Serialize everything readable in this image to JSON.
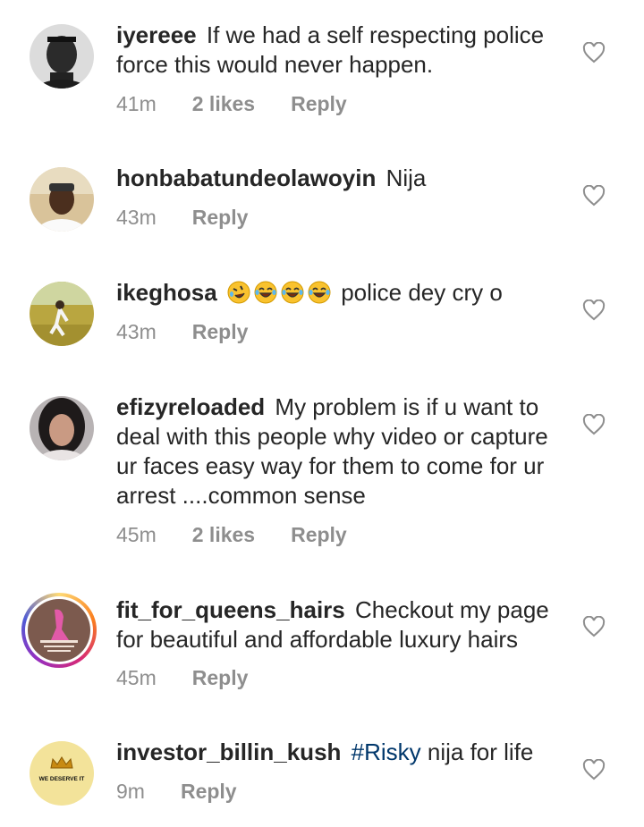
{
  "comments": [
    {
      "username": "iyereee",
      "text": "If we had a self respecting police force this would never happen.",
      "time": "41m",
      "likes": "2 likes",
      "reply": "Reply"
    },
    {
      "username": "honbabatundeolawoyin",
      "text": "Nija",
      "time": "43m",
      "reply": "Reply"
    },
    {
      "username": "ikeghosa",
      "emojis": [
        "rolling-on-floor-laughing",
        "face-with-tears-of-joy",
        "face-with-tears-of-joy",
        "face-with-tears-of-joy"
      ],
      "text": "police dey cry o",
      "time": "43m",
      "reply": "Reply"
    },
    {
      "username": "efizyreloaded",
      "text": "My problem is if u want to deal with this people why video or capture ur faces easy way for them to come for ur arrest ....common sense",
      "time": "45m",
      "likes": "2 likes",
      "reply": "Reply"
    },
    {
      "username": "fit_for_queens_hairs",
      "text": "Checkout my page for beautiful and affordable luxury hairs",
      "time": "45m",
      "reply": "Reply"
    },
    {
      "username": "investor_billin_kush",
      "hashtag": "#Risky",
      "text": "nija for life",
      "time": "9m",
      "reply": "Reply",
      "avatar_text": "WE DESERVE IT"
    }
  ],
  "colors": {
    "text": "#262626",
    "meta": "#8e8e8e",
    "hashtag": "#00376b"
  },
  "icons": {
    "like": "heart-outline-icon"
  }
}
